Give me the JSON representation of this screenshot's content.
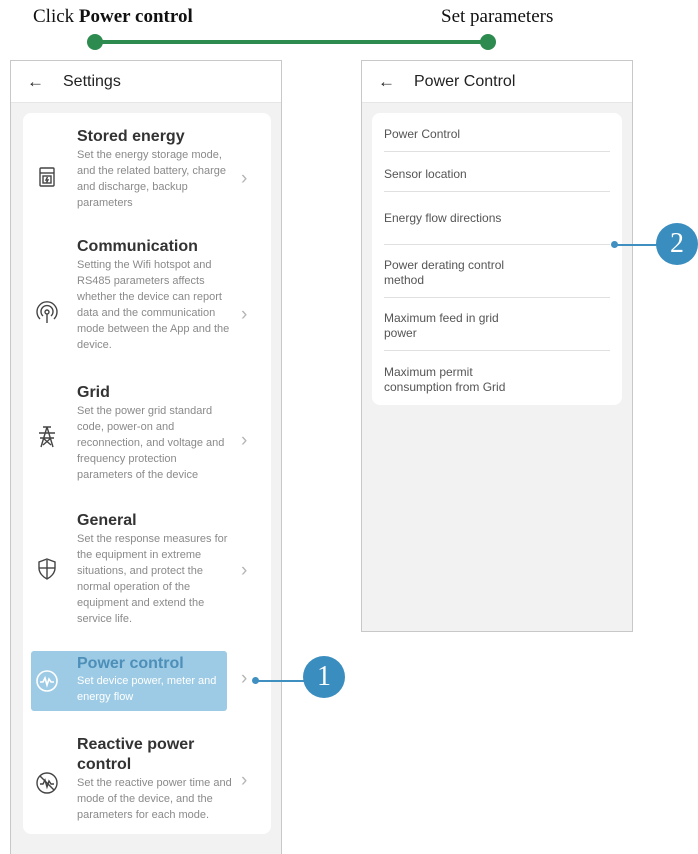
{
  "caption": {
    "left_prefix": "Click ",
    "left_bold": "Power control",
    "right": "Set parameters"
  },
  "colors": {
    "progress": "#2e8b4f",
    "callout": "#3a8dbf",
    "highlight": "#9dcbe5"
  },
  "settings_screen": {
    "back_icon": "arrow-left-icon",
    "title": "Settings",
    "items": [
      {
        "icon": "storage-icon",
        "title": "Stored energy",
        "desc": "Set the energy storage mode, and the related battery, charge and discharge, backup parameters"
      },
      {
        "icon": "antenna-icon",
        "title": "Communication",
        "desc": "Setting the Wifi hotspot and RS485 parameters affects whether the device can report data and the communication mode between the App and the device."
      },
      {
        "icon": "grid-tower-icon",
        "title": "Grid",
        "desc": "Set the power grid standard code, power-on and reconnection, and voltage and frequency protection parameters of the device"
      },
      {
        "icon": "shield-icon",
        "title": "General",
        "desc": "Set the response measures for the equipment in extreme situations, and protect the normal operation of the equipment and extend the service life."
      },
      {
        "icon": "power-wave-icon",
        "title": "Power control",
        "desc": "Set device power, meter and energy flow"
      },
      {
        "icon": "reactive-power-icon",
        "title": "Reactive power control",
        "desc": "Set the reactive power time and mode of the device, and the parameters for each mode."
      }
    ]
  },
  "power_control_screen": {
    "back_icon": "arrow-left-icon",
    "title": "Power Control",
    "items": [
      "Power Control",
      "Sensor location",
      "Energy flow directions",
      "Power derating control method",
      "Maximum feed in grid power",
      "Maximum permit consumption from Grid"
    ]
  },
  "callouts": [
    "1",
    "2"
  ]
}
